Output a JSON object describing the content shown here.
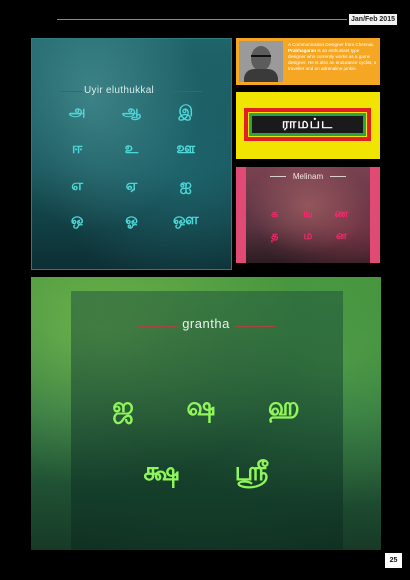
{
  "header": {
    "issue": "Jan/Feb 2015"
  },
  "uyir_panel": {
    "title": "Uyir eluthukkal",
    "rows": [
      [
        "அ",
        "ஆ",
        "இ"
      ],
      [
        "ஈ",
        "உ",
        "ஊ"
      ],
      [
        "எ",
        "ஏ",
        "ஐ"
      ],
      [
        "ஒ",
        "ஓ",
        "ஔ"
      ]
    ]
  },
  "bio": {
    "name": "Prabhagaran",
    "text_before": "A Communication Designer from Chennai,",
    "text_after": "is an enthusiast type designer who currently works as a game designer. He is also an endurance cyclist, a traveller and an adrenaline junkie."
  },
  "logo": {
    "word": "ராமப்ட"
  },
  "melinam_panel": {
    "title": "Melinam",
    "rows": [
      [
        "க",
        "ங",
        "ண"
      ],
      [
        "த",
        "ம",
        "ன"
      ]
    ]
  },
  "grantha_panel": {
    "title": "grantha",
    "rows": [
      [
        "ஜ",
        "ஷ",
        "ஹ"
      ],
      [
        "க்ஷ",
        "ஸ்ரீ"
      ]
    ]
  },
  "footer": {
    "page_number": "25"
  },
  "colors": {
    "uyir_glyph": "#4dd7d7",
    "bio_bg": "#f5a623",
    "logo_bg": "#f1e400",
    "melinam_accent": "#e14a74",
    "grantha_glyph": "#8ff55a"
  }
}
